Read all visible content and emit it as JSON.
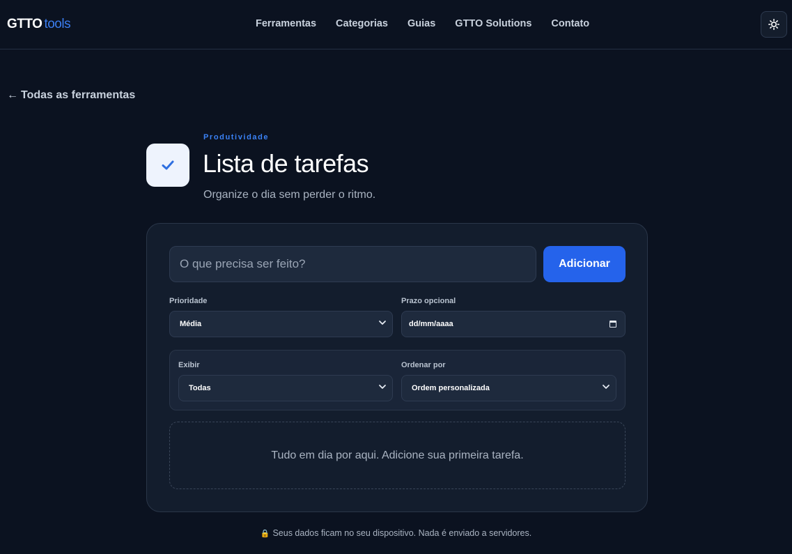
{
  "header": {
    "brand": "GTTO",
    "brand_sub": "tools",
    "nav": [
      "Ferramentas",
      "Categorias",
      "Guias",
      "GTTO Solutions",
      "Contato"
    ],
    "theme_icon": "sun-icon"
  },
  "back_link": {
    "label": "Todas as ferramentas",
    "icon": "arrow-left-icon"
  },
  "tool": {
    "category": "Produtividade",
    "title": "Lista de tarefas",
    "subtitle": "Organize o dia sem perder o ritmo.",
    "icon": "checkmark-icon"
  },
  "form": {
    "task_placeholder": "O que precisa ser feito?",
    "task_value": "",
    "add_label": "Adicionar",
    "priority_label": "Prioridade",
    "priority_value": "Média",
    "deadline_label": "Prazo opcional",
    "deadline_placeholder": "dd/mm/aaaa"
  },
  "filters": {
    "show_label": "Exibir",
    "show_value": "Todas",
    "sort_label": "Ordenar por",
    "sort_value": "Ordem personalizada"
  },
  "empty_state": "Tudo em dia por aqui. Adicione sua primeira tarefa.",
  "footer_note": "Seus dados ficam no seu dispositivo. Nada é enviado a servidores.",
  "colors": {
    "background": "#0b1220",
    "accent": "#2563eb",
    "brand_accent": "#3b7df0",
    "card": "#131d2d"
  }
}
